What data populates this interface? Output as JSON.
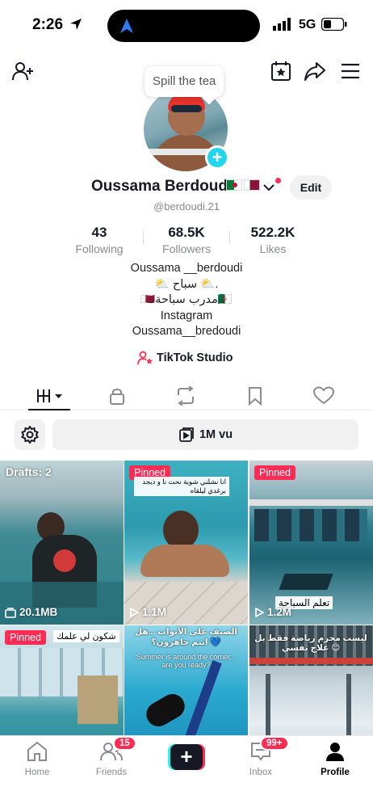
{
  "status_bar": {
    "time": "2:26",
    "network": "5G"
  },
  "header": {
    "tooltip": "Spill the tea"
  },
  "profile": {
    "name": "Oussama Berdoudi",
    "handle": "@berdoudi.21",
    "edit_label": "Edit",
    "stats": [
      {
        "value": "43",
        "label": "Following"
      },
      {
        "value": "68.5K",
        "label": "Followers"
      },
      {
        "value": "522.2K",
        "label": "Likes"
      }
    ],
    "bio": [
      "Oussama __berdoudi",
      "⛅ سباح ⛅.",
      "🇶🇦مدرب سباحة🇩🇿",
      "Instagram",
      "Oussama__bredoudi"
    ],
    "studio_label": "TikTok Studio"
  },
  "views_bar": {
    "label": "1M vu"
  },
  "videos": [
    {
      "overlay": "Drafts: 2",
      "stat": "20.1MB",
      "stat_icon": "drafts-icon"
    },
    {
      "badge": "Pinned",
      "caption": "انا نشلني شوية نحت نا و ديجد برغدي ليلقاه",
      "stat": "1.1M",
      "stat_icon": "play-icon"
    },
    {
      "badge": "Pinned",
      "caption": "تعلم السباحة",
      "stat": "1.2M",
      "stat_icon": "play-icon"
    },
    {
      "badge": "Pinned",
      "caption": "شكون لي علمك"
    },
    {
      "caption": "الصيف على الأبواب ...هل انتم جاهزون؟ 💙",
      "caption2": "Summer is around the corner... are you ready?"
    },
    {
      "caption": "ليست محرم رياضة فقط بل علاج نفسي 😊"
    }
  ],
  "bottom_nav": [
    {
      "label": "Home",
      "icon": "home-icon"
    },
    {
      "label": "Friends",
      "icon": "friends-icon",
      "badge": "15"
    },
    {
      "label": "",
      "icon": "create-icon"
    },
    {
      "label": "Inbox",
      "icon": "inbox-icon",
      "badge": "99+"
    },
    {
      "label": "Profile",
      "icon": "profile-icon",
      "active": true
    }
  ],
  "colors": {
    "accent": "#fe2c55",
    "cyan": "#25f4ee",
    "text": "#161823",
    "muted": "#8a8b91"
  }
}
